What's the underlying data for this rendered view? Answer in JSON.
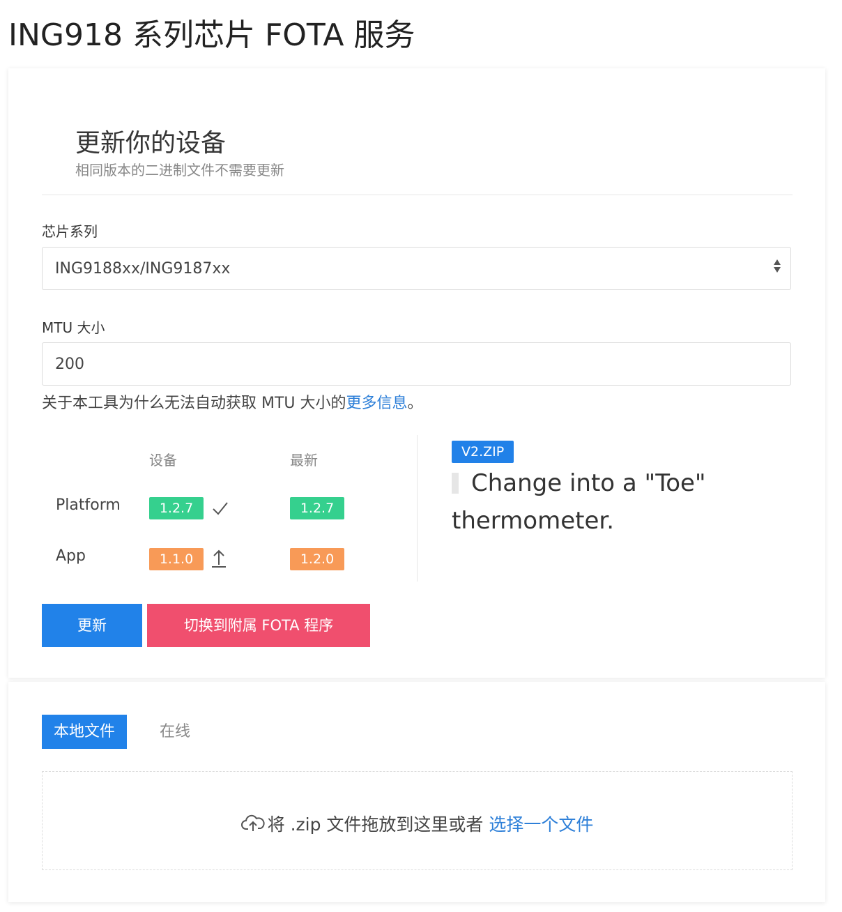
{
  "page": {
    "title": "ING918 系列芯片 FOTA 服务"
  },
  "hero": {
    "title": "更新你的设备",
    "subtitle": "相同版本的二进制文件不需要更新"
  },
  "form": {
    "chip_series": {
      "label": "芯片系列",
      "value": "ING9188xx/ING9187xx"
    },
    "mtu": {
      "label": "MTU 大小",
      "value": "200"
    },
    "help": {
      "text": "关于本工具为什么无法自动获取 MTU 大小的",
      "link": "更多信息",
      "end": "。"
    }
  },
  "versions": {
    "header_device": "设备",
    "header_latest": "最新",
    "rows": [
      {
        "name": "Platform",
        "device": "1.2.7",
        "latest": "1.2.7",
        "status_icon": "check-icon",
        "color": "#35d08e"
      },
      {
        "name": "App",
        "device": "1.1.0",
        "latest": "1.2.0",
        "status_icon": "arrow-up-icon",
        "color": "#f89a57"
      }
    ]
  },
  "package": {
    "tag": "V2.ZIP",
    "note": "Change into a \"Toe\" thermometer."
  },
  "buttons": {
    "update": "更新",
    "switch": "切换到附属 FOTA 程序"
  },
  "source_tabs": {
    "local": "本地文件",
    "online": "在线"
  },
  "dropzone": {
    "text": "将 .zip 文件拖放到这里或者",
    "link": "选择一个文件",
    "icon": "cloud-upload-icon"
  },
  "colors": {
    "primary": "#2182e9",
    "danger": "#f04f6e",
    "success": "#35d08e",
    "warning": "#f89a57",
    "link": "#2d7fd8"
  }
}
